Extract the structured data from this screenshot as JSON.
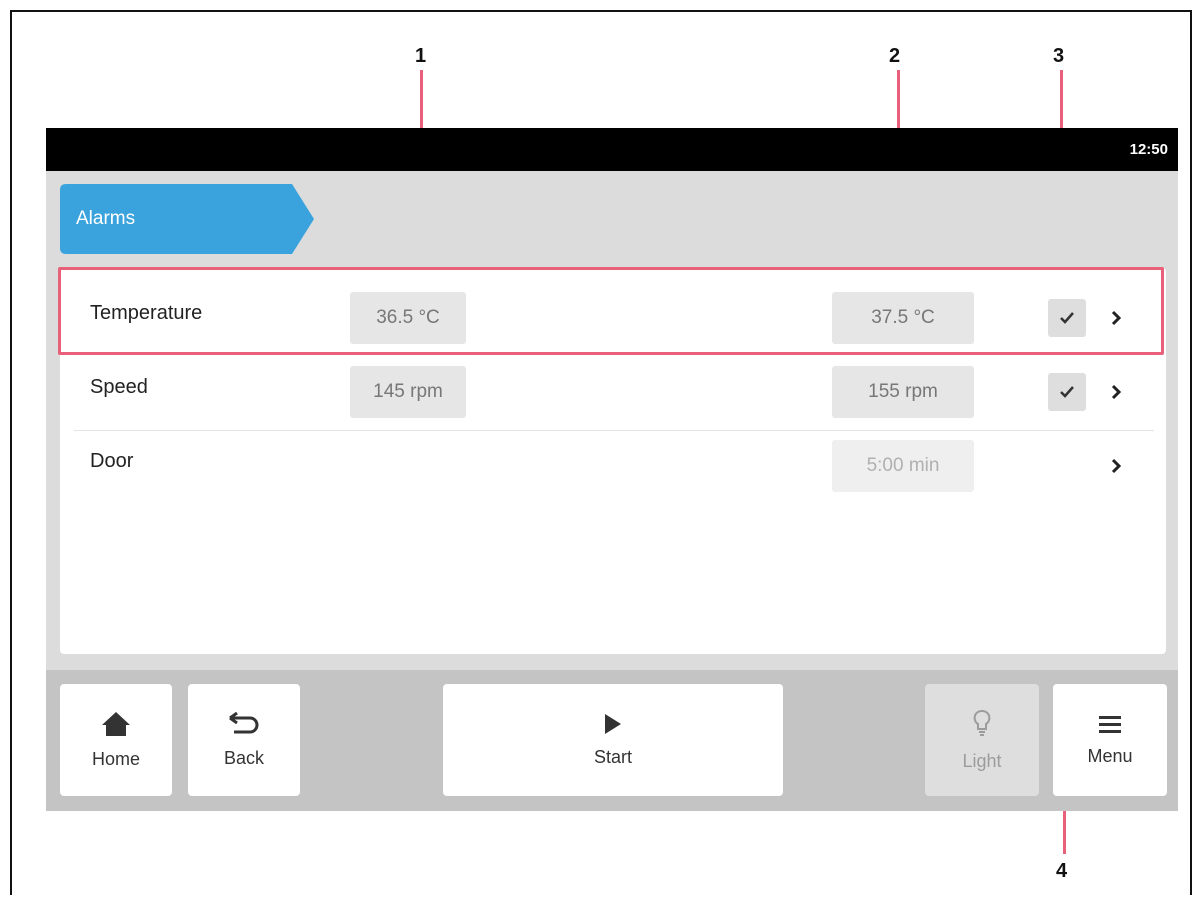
{
  "status_bar": {
    "time": "12:50"
  },
  "breadcrumb": {
    "label": "Alarms",
    "color": "#3aa2dc"
  },
  "alarms": [
    {
      "label": "Temperature",
      "min": "36.5 °C",
      "max": "37.5 °C",
      "enabled": true
    },
    {
      "label": "Speed",
      "min": "145 rpm",
      "max": "155 rpm",
      "enabled": true
    },
    {
      "label": "Door",
      "min": "",
      "max": "5:00 min",
      "enabled": false
    }
  ],
  "nav": {
    "home": "Home",
    "back": "Back",
    "start": "Start",
    "light": "Light",
    "menu": "Menu"
  },
  "callouts": [
    "1",
    "2",
    "3",
    "4"
  ],
  "colors": {
    "callout": "#e8607a",
    "status_bar": "#000000"
  }
}
